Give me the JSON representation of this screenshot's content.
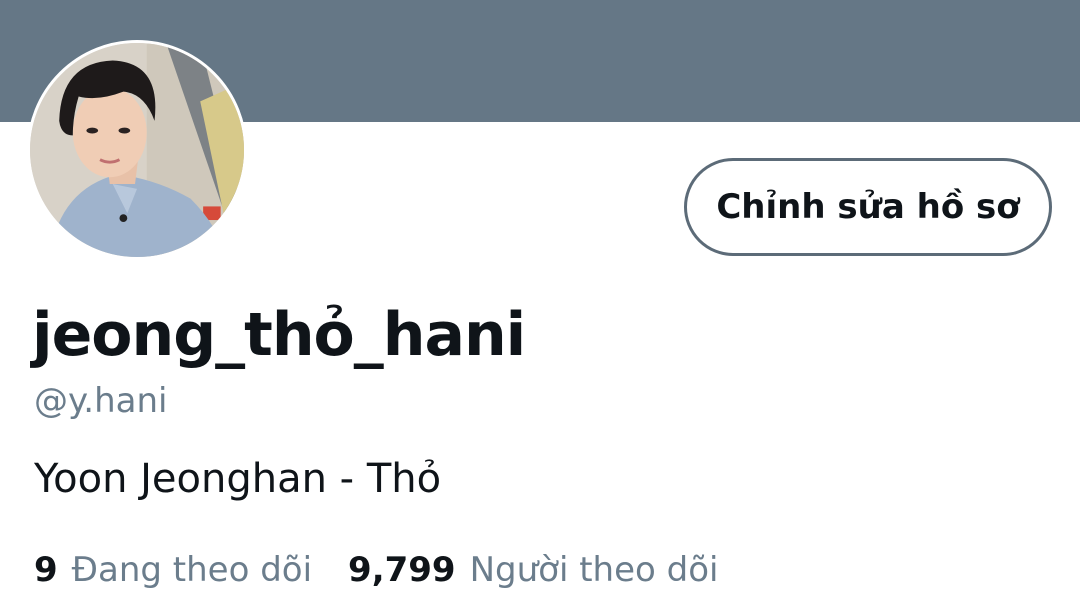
{
  "colors": {
    "banner": "#657786",
    "text_primary": "#0f1419",
    "text_secondary": "#6b7d8c",
    "button_border": "#5c6b78"
  },
  "profile": {
    "avatar_icon": "profile-photo",
    "edit_button_label": "Chỉnh sửa hồ sơ",
    "display_name": "jeong_thỏ_hani",
    "handle": "@y.hani",
    "bio": "Yoon Jeonghan - Thỏ"
  },
  "stats": {
    "following_count": "9",
    "following_label": "Đang theo dõi",
    "followers_count": "9,799",
    "followers_label": "Người theo dõi"
  }
}
